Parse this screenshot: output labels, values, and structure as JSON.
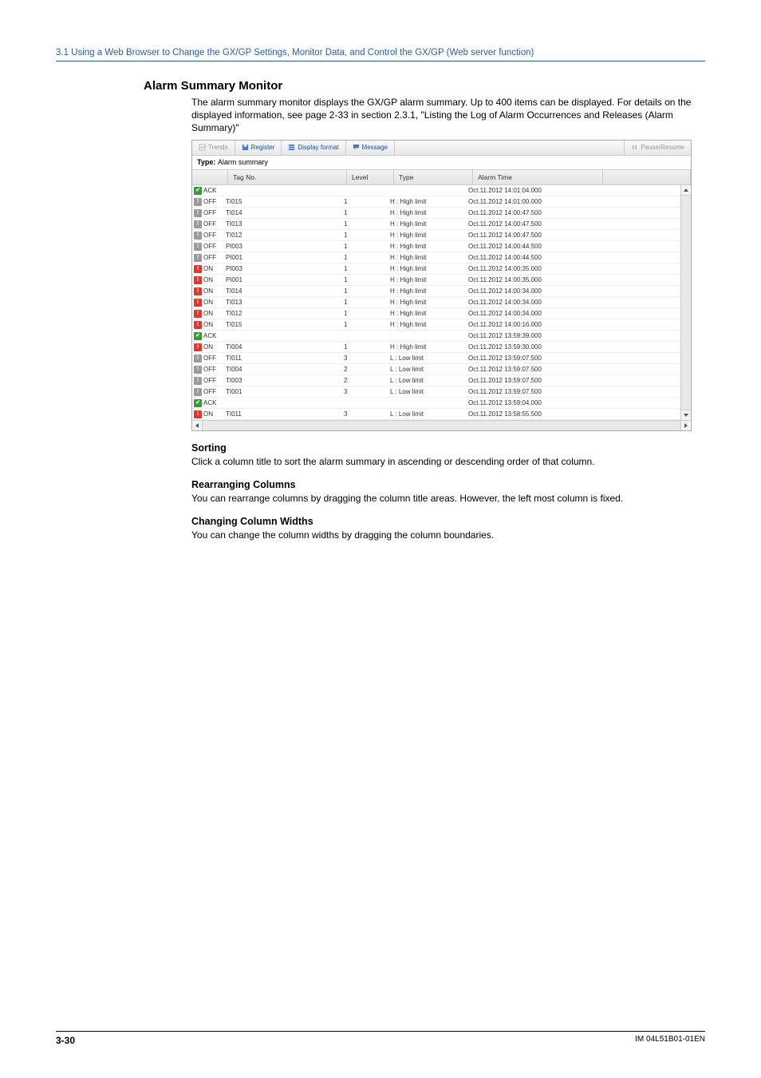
{
  "section_link": "3.1  Using a Web Browser to Change the GX/GP Settings, Monitor Data, and Control the GX/GP (Web server function)",
  "heading": "Alarm Summary Monitor",
  "intro": "The alarm summary monitor displays the GX/GP alarm summary. Up to 400 items can be displayed. For details on the displayed information, see page 2-33 in section 2.3.1, \"Listing the Log of Alarm Occurrences and Releases (Alarm Summary)\"",
  "toolbar": {
    "btn_trends": "Trends",
    "btn_register": "Register",
    "btn_display_format": "Display format",
    "btn_message": "Message",
    "btn_pause": "Pause/Resume"
  },
  "type_row": {
    "label": "Type: ",
    "value": "Alarm summary"
  },
  "columns": {
    "status": "",
    "tag": "Tag No.",
    "level": "Level",
    "type": "Type",
    "time": "Alarm Time"
  },
  "rows": [
    {
      "status": "ACK",
      "icon": "green",
      "tag": "",
      "level": "",
      "type": "",
      "time": "Oct.11.2012 14:01:04.000"
    },
    {
      "status": "OFF",
      "icon": "grey",
      "tag": "TI015",
      "level": "1",
      "type": "H : High limit",
      "time": "Oct.11.2012 14:01:00.000"
    },
    {
      "status": "OFF",
      "icon": "grey",
      "tag": "TI014",
      "level": "1",
      "type": "H : High limit",
      "time": "Oct.11.2012 14:00:47.500"
    },
    {
      "status": "OFF",
      "icon": "grey",
      "tag": "TI013",
      "level": "1",
      "type": "H : High limit",
      "time": "Oct.11.2012 14:00:47.500"
    },
    {
      "status": "OFF",
      "icon": "grey",
      "tag": "TI012",
      "level": "1",
      "type": "H : High limit",
      "time": "Oct.11.2012 14:00:47.500"
    },
    {
      "status": "OFF",
      "icon": "grey",
      "tag": "PI003",
      "level": "1",
      "type": "H : High limit",
      "time": "Oct.11.2012 14:00:44.500"
    },
    {
      "status": "OFF",
      "icon": "grey",
      "tag": "PI001",
      "level": "1",
      "type": "H : High limit",
      "time": "Oct.11.2012 14:00:44.500"
    },
    {
      "status": "ON",
      "icon": "red",
      "tag": "PI003",
      "level": "1",
      "type": "H : High limit",
      "time": "Oct.11.2012 14:00:35.000"
    },
    {
      "status": "ON",
      "icon": "red",
      "tag": "PI001",
      "level": "1",
      "type": "H : High limit",
      "time": "Oct.11.2012 14:00:35.000"
    },
    {
      "status": "ON",
      "icon": "red",
      "tag": "TI014",
      "level": "1",
      "type": "H : High limit",
      "time": "Oct.11.2012 14:00:34.000"
    },
    {
      "status": "ON",
      "icon": "red",
      "tag": "TI013",
      "level": "1",
      "type": "H : High limit",
      "time": "Oct.11.2012 14:00:34.000"
    },
    {
      "status": "ON",
      "icon": "red",
      "tag": "TI012",
      "level": "1",
      "type": "H : High limit",
      "time": "Oct.11.2012 14:00:34.000"
    },
    {
      "status": "ON",
      "icon": "red",
      "tag": "TI015",
      "level": "1",
      "type": "H : High limit",
      "time": "Oct.11.2012 14:00:16.000"
    },
    {
      "status": "ACK",
      "icon": "green",
      "tag": "",
      "level": "",
      "type": "",
      "time": "Oct.11.2012 13:59:39.000"
    },
    {
      "status": "ON",
      "icon": "red",
      "tag": "TI004",
      "level": "1",
      "type": "H : High limit",
      "time": "Oct.11.2012 13:59:30.000"
    },
    {
      "status": "OFF",
      "icon": "grey",
      "tag": "TI011",
      "level": "3",
      "type": "L : Low limit",
      "time": "Oct.11.2012 13:59:07.500"
    },
    {
      "status": "OFF",
      "icon": "grey",
      "tag": "TI004",
      "level": "2",
      "type": "L : Low limit",
      "time": "Oct.11.2012 13:59:07.500"
    },
    {
      "status": "OFF",
      "icon": "grey",
      "tag": "TI003",
      "level": "2",
      "type": "L : Low limit",
      "time": "Oct.11.2012 13:59:07.500"
    },
    {
      "status": "OFF",
      "icon": "grey",
      "tag": "TI001",
      "level": "3",
      "type": "L : Low limit",
      "time": "Oct.11.2012 13:59:07.500"
    },
    {
      "status": "ACK",
      "icon": "green",
      "tag": "",
      "level": "",
      "type": "",
      "time": "Oct.11.2012 13:59:04.000"
    },
    {
      "status": "ON",
      "icon": "red",
      "tag": "TI011",
      "level": "3",
      "type": "L : Low limit",
      "time": "Oct.11.2012 13:58:55.500"
    }
  ],
  "sections": {
    "sorting_h": "Sorting",
    "sorting_b": "Click a column title to sort the alarm summary in ascending or descending order of that column.",
    "rearr_h": "Rearranging Columns",
    "rearr_b": "You can rearrange columns by dragging the column title areas. However, the left most column is fixed.",
    "width_h": "Changing Column Widths",
    "width_b": "You can change the column widths by dragging the column boundaries."
  },
  "footer": {
    "page": "3-30",
    "doc": "IM 04L51B01-01EN"
  }
}
